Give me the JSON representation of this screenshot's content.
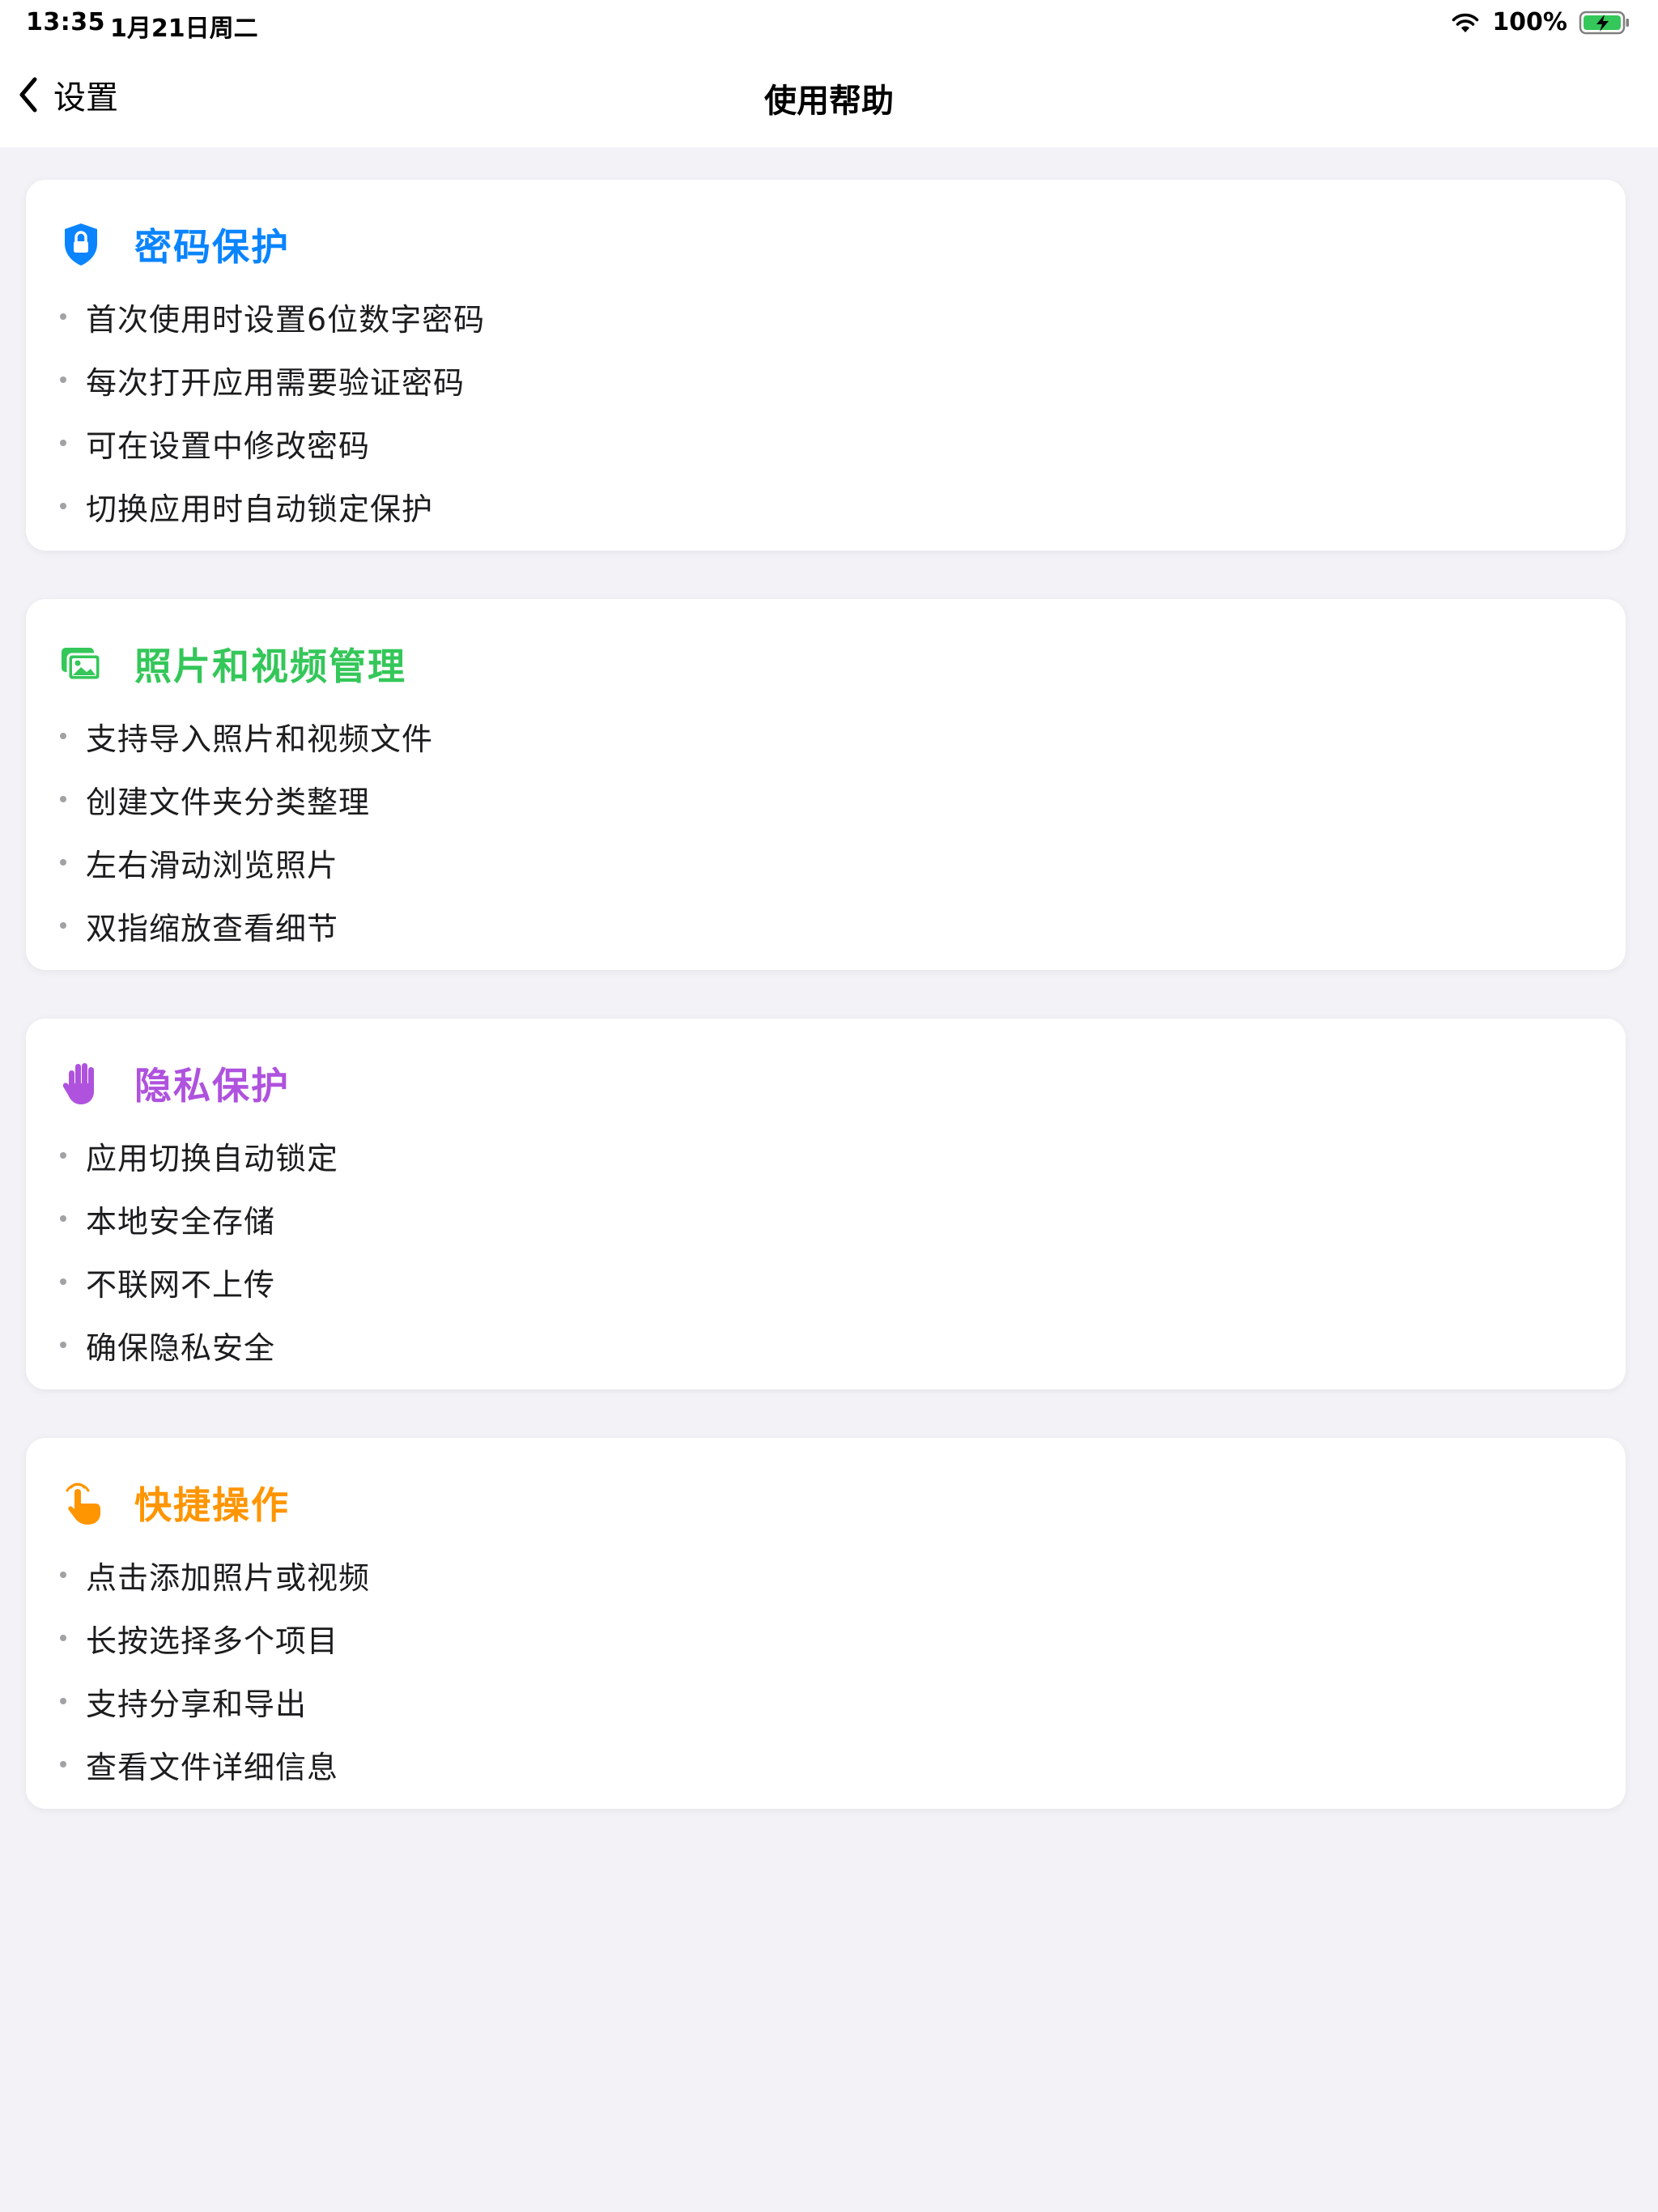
{
  "status": {
    "time": "13:35",
    "date": "1月21日周二",
    "battery": "100%",
    "wifi_icon": "wifi-icon",
    "battery_icon": "battery-charging-icon"
  },
  "nav": {
    "back_label": "设置",
    "back_icon": "chevron-left-icon",
    "title": "使用帮助"
  },
  "sections": [
    {
      "title": "密码保护",
      "icon": "lock-shield-icon",
      "color": "#0a84ff",
      "items": [
        "首次使用时设置6位数字密码",
        "每次打开应用需要验证密码",
        "可在设置中修改密码",
        "切换应用时自动锁定保护"
      ]
    },
    {
      "title": "照片和视频管理",
      "icon": "photo-stack-icon",
      "color": "#34c759",
      "items": [
        "支持导入照片和视频文件",
        "创建文件夹分类整理",
        "左右滑动浏览照片",
        "双指缩放查看细节"
      ]
    },
    {
      "title": "隐私保护",
      "icon": "hand-raised-icon",
      "color": "#af52de",
      "items": [
        "应用切换自动锁定",
        "本地安全存储",
        "不联网不上传",
        "确保隐私安全"
      ]
    },
    {
      "title": "快捷操作",
      "icon": "hand-tap-icon",
      "color": "#ff9500",
      "items": [
        "点击添加照片或视频",
        "长按选择多个项目",
        "支持分享和导出",
        "查看文件详细信息"
      ]
    }
  ]
}
